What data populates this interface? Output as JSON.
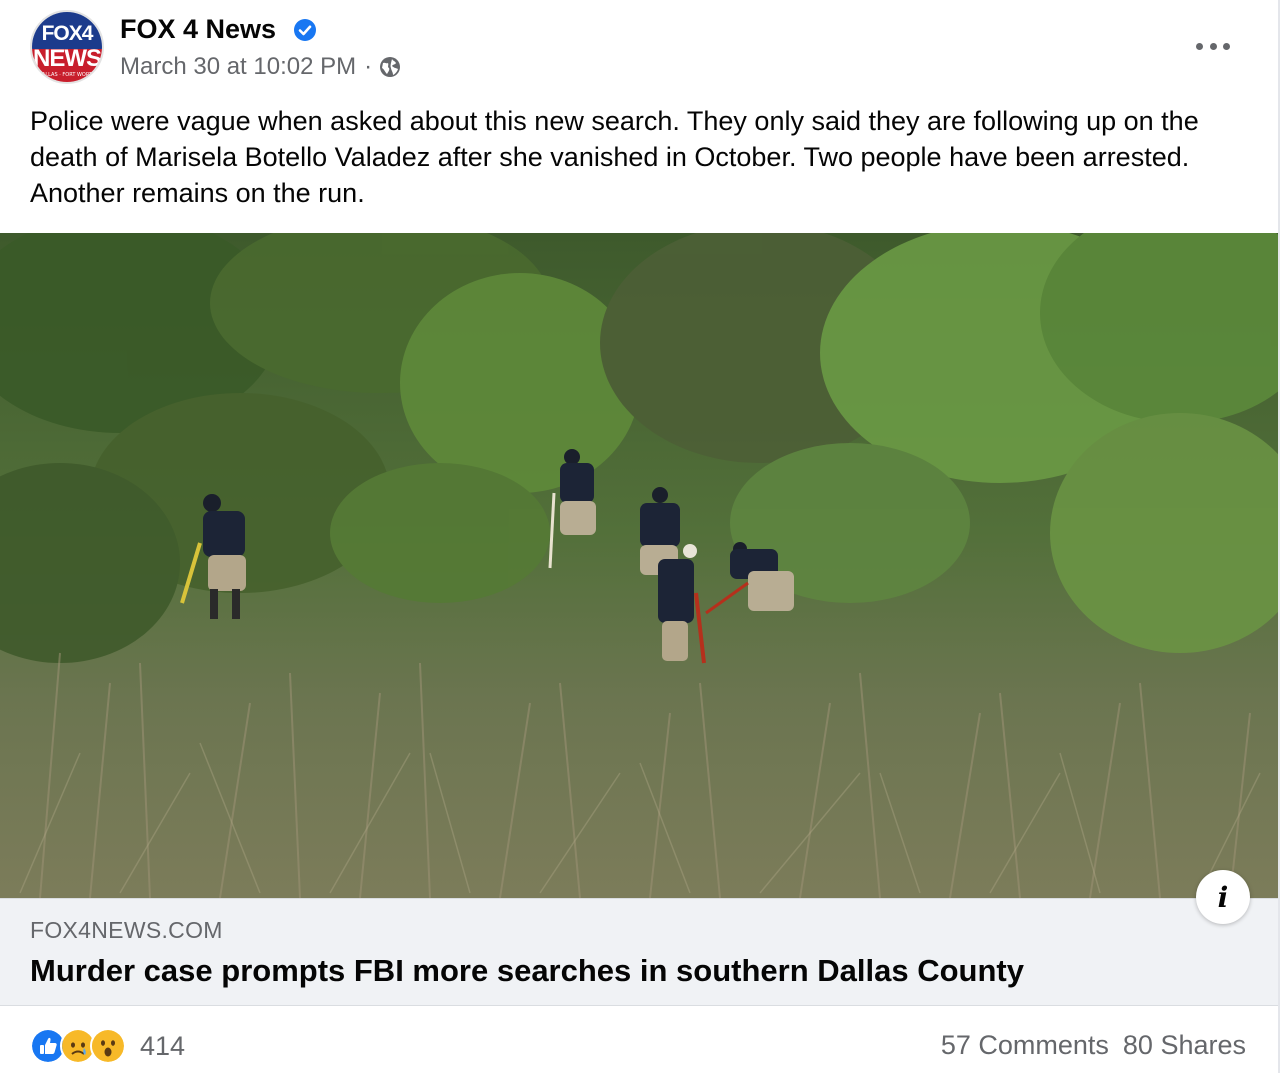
{
  "post": {
    "page_name": "FOX 4 News",
    "avatar": {
      "line1": "FOX4",
      "line2": "NEWS",
      "line3": "DALLAS · FORT WORTH"
    },
    "timestamp": "March 30 at 10:02 PM",
    "separator": "·",
    "privacy_icon": "globe-icon",
    "more_icon": "more-options-icon",
    "text": "Police were vague when asked about this new search. They only said they are following up on the death of Marisela Botello Valadez after she vanished in October. Two people have been arrested. Another remains on the run."
  },
  "link_preview": {
    "domain": "FOX4NEWS.COM",
    "title": "Murder case prompts FBI more searches in southern Dallas County",
    "info_icon": "i"
  },
  "footer": {
    "reactions": [
      "like-icon",
      "sad-icon",
      "wow-icon"
    ],
    "reaction_count": "414",
    "comments": "57 Comments",
    "shares": "80 Shares"
  },
  "colors": {
    "brand_blue": "#1877f2",
    "muted_text": "#65676b",
    "link_bg": "#f0f2f5"
  }
}
